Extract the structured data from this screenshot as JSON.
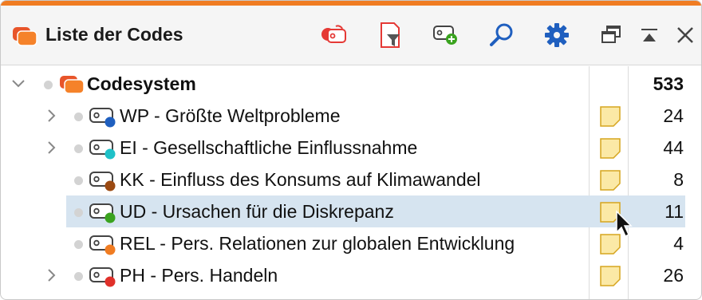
{
  "header": {
    "title": "Liste der Codes",
    "icons": [
      "codes-icon",
      "filter-icon",
      "new-code-icon",
      "search-icon",
      "gear-icon",
      "undock-icon",
      "collapse-icon",
      "close-icon"
    ]
  },
  "tree": {
    "root": {
      "label": "Codesystem",
      "count": "533"
    },
    "rows": [
      {
        "label": "WP - Größte Weltprobleme",
        "count": "24",
        "color": "#1f5fbf",
        "expandable": true,
        "memo": true
      },
      {
        "label": "EI - Gesellschaftliche Einflussnahme",
        "count": "44",
        "color": "#1fc1c8",
        "expandable": true,
        "memo": true
      },
      {
        "label": "KK - Einfluss des Konsums auf Klimawandel",
        "count": "8",
        "color": "#9b4a12",
        "expandable": false,
        "memo": true
      },
      {
        "label": "UD - Ursachen für die Diskrepanz",
        "count": "11",
        "color": "#3aa31f",
        "expandable": false,
        "memo": true,
        "selected": true
      },
      {
        "label": "REL - Pers. Relationen zur globalen Entwicklung",
        "count": "4",
        "color": "#f07c22",
        "expandable": false,
        "memo": true
      },
      {
        "label": "PH - Pers. Handeln",
        "count": "26",
        "color": "#e0302a",
        "expandable": true,
        "memo": true
      }
    ]
  },
  "colors": {
    "accent": "#f07c22",
    "selection": "#d6e4f0",
    "memo": "#fbe9a6"
  }
}
